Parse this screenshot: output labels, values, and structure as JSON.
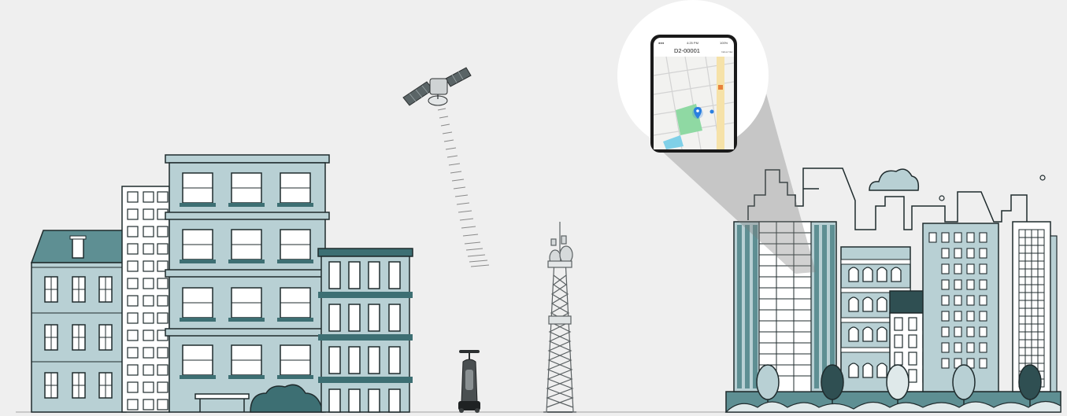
{
  "phone": {
    "status_time": "4:25 PM",
    "status_battery": "100%",
    "device_id": "D2-00001",
    "top_right_label": "Indoor Nav"
  },
  "colors": {
    "background": "#efefef",
    "building_light": "#b8d0d4",
    "building_dark": "#3d6f73",
    "building_mid": "#5e8f93",
    "outline": "#1f2b2d",
    "map_green": "#8fd9a3",
    "map_water": "#7fd0e8",
    "pin_blue": "#2a7fe0"
  },
  "icons": [
    "satellite-icon",
    "cell-tower-icon",
    "scrubber-robot-icon",
    "map-pin-icon",
    "cloud-icon"
  ]
}
